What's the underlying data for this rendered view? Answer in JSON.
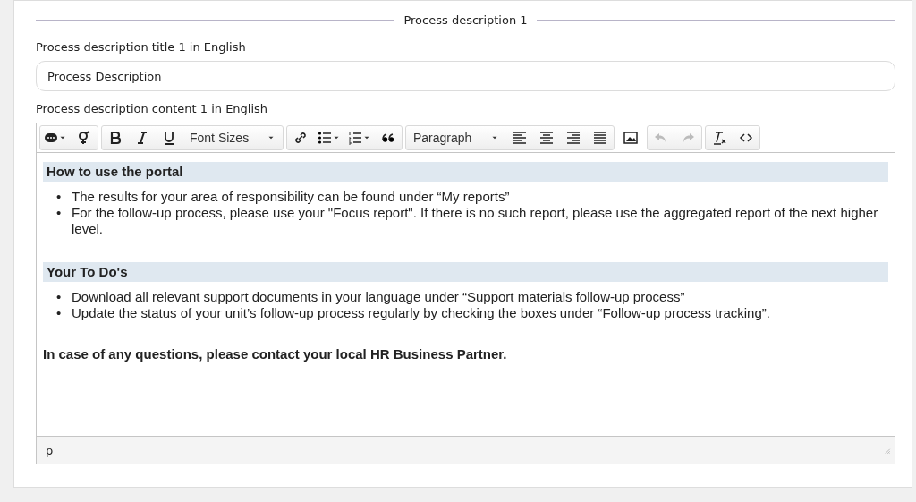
{
  "section_title": "Process description 1",
  "title_field": {
    "label": "Process description title 1 in English",
    "value": "Process Description"
  },
  "content_field": {
    "label": "Process description content 1 in English",
    "toolbar": {
      "font_sizes": "Font Sizes",
      "block_format": "Paragraph",
      "undo_disabled": true,
      "redo_disabled": true
    },
    "blocks": [
      {
        "kind": "heading",
        "text": "How to use the portal"
      },
      {
        "kind": "list",
        "items": [
          {
            "marker": "•",
            "text": "The results for your area of responsibility can be found under “My reports”"
          },
          {
            "marker": "•",
            "text": "For the follow-up process, please use your \"Focus report\". If there is no such report, please use the aggregated report of the next higher level."
          }
        ]
      },
      {
        "kind": "spacer"
      },
      {
        "kind": "heading",
        "text": "Your To Do's"
      },
      {
        "kind": "list",
        "items": [
          {
            "marker": "•",
            "text": "Download all relevant support documents in your language under “Support materials follow-up process”"
          },
          {
            "marker": "•",
            "text": "Update the status of your unit’s follow-up process regularly by checking the boxes under “Follow-up process tracking”."
          }
        ]
      },
      {
        "kind": "spacer"
      },
      {
        "kind": "bold",
        "text": "In case of any questions, please contact your local HR Business Partner."
      }
    ],
    "status_path": "p"
  }
}
